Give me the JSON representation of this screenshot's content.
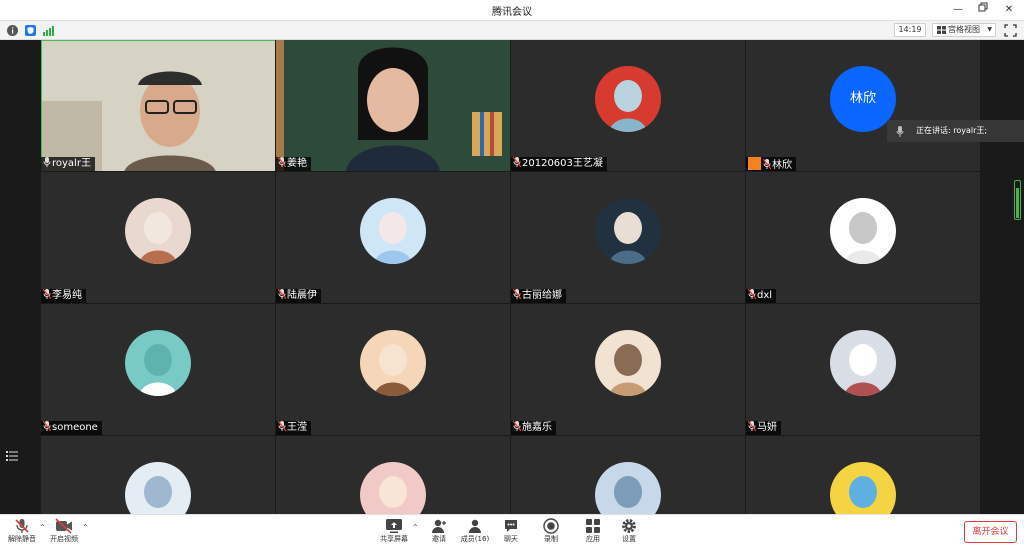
{
  "window": {
    "title": "腾讯会议"
  },
  "status": {
    "time": "14:19",
    "view_mode": "宫格视图"
  },
  "speaking": {
    "label": "正在讲话: royalr王;"
  },
  "participants": [
    {
      "name": "royalr王",
      "mic": "on",
      "kind": "video",
      "bg": "#cfcabd"
    },
    {
      "name": "姜艳",
      "mic": "muted",
      "kind": "video",
      "bg": "#2e4a3b"
    },
    {
      "name": "20120603王艺凝",
      "mic": "muted",
      "kind": "avatar",
      "colors": [
        "#d73b2f",
        "#88b5c9",
        "#b9d4df"
      ]
    },
    {
      "name": "林欣",
      "mic": "muted",
      "kind": "initials",
      "initials": "林欣",
      "color": "#0a66ff",
      "host": true
    },
    {
      "name": "李易纯",
      "mic": "muted",
      "kind": "avatar",
      "colors": [
        "#e8d8cf",
        "#b86f4f",
        "#f1e7df"
      ]
    },
    {
      "name": "陆晨伊",
      "mic": "muted",
      "kind": "avatar",
      "colors": [
        "#cfe6f7",
        "#9dc7ec",
        "#f4e7ea"
      ]
    },
    {
      "name": "古丽给娜",
      "mic": "muted",
      "kind": "avatar",
      "colors": [
        "#22313f",
        "#4b6d8a",
        "#e9ded4"
      ]
    },
    {
      "name": "dxl",
      "mic": "muted",
      "kind": "avatar",
      "colors": [
        "#ffffff",
        "#e9e9e9",
        "#c8c8c8"
      ]
    },
    {
      "name": "someone",
      "mic": "muted",
      "kind": "avatar",
      "colors": [
        "#79c9c5",
        "#ffffff",
        "#5fb3ae"
      ]
    },
    {
      "name": "王滢",
      "mic": "muted",
      "kind": "avatar",
      "colors": [
        "#f5d6b8",
        "#8a5a3a",
        "#f7e4d0"
      ]
    },
    {
      "name": "施嘉乐",
      "mic": "muted",
      "kind": "avatar",
      "colors": [
        "#f1e2d2",
        "#c79c74",
        "#8a6b54"
      ]
    },
    {
      "name": "马妍",
      "mic": "muted",
      "kind": "avatar",
      "colors": [
        "#d9dde6",
        "#b05050",
        "#ffffff"
      ]
    },
    {
      "name": "",
      "mic": "none",
      "kind": "avatar",
      "colors": [
        "#e4ecf4",
        "#3a3a52",
        "#9fb7d1"
      ]
    },
    {
      "name": "",
      "mic": "none",
      "kind": "avatar",
      "colors": [
        "#f1c9c6",
        "#e7a7b8",
        "#f8e5d6"
      ]
    },
    {
      "name": "",
      "mic": "none",
      "kind": "avatar",
      "colors": [
        "#c6d8ea",
        "#f0d2bd",
        "#7d9cb8"
      ]
    },
    {
      "name": "",
      "mic": "none",
      "kind": "avatar",
      "colors": [
        "#f5d443",
        "#e86f8f",
        "#5fb0e0"
      ]
    }
  ],
  "toolbar": {
    "unmute": "解除静音",
    "start_video": "开启视频",
    "share": "共享屏幕",
    "invite": "邀请",
    "members": "成员(16)",
    "chat": "聊天",
    "record": "录制",
    "apps": "应用",
    "settings": "设置",
    "leave": "离开会议"
  }
}
